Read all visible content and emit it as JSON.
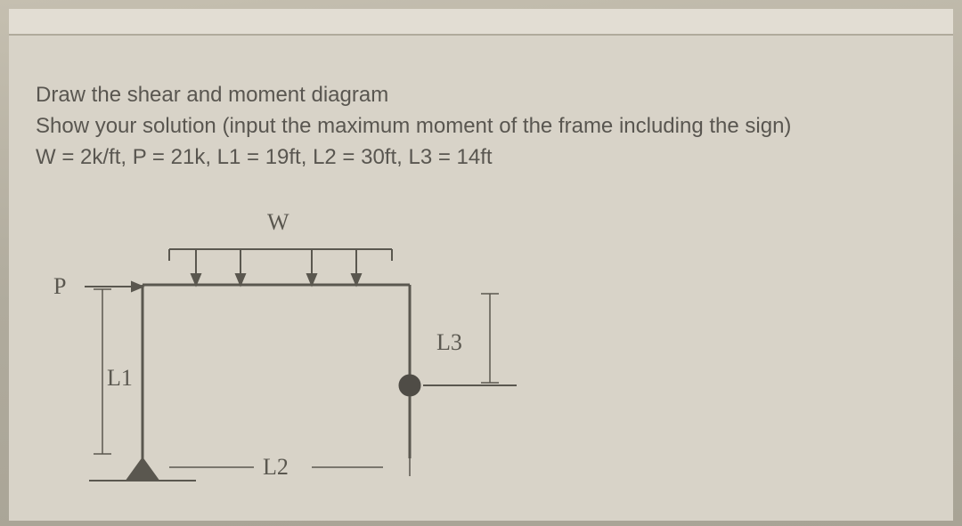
{
  "problem": {
    "line1": "Draw the shear and moment diagram",
    "line2": "Show your solution (input the maximum moment of the frame including the sign)",
    "line3": "W = 2k/ft, P = 21k, L1 = 19ft, L2 = 30ft, L3 = 14ft"
  },
  "diagram": {
    "label_W": "W",
    "label_P": "P",
    "label_L1": "L1",
    "label_L2": "L2",
    "label_L3": "L3"
  },
  "values": {
    "W": "2k/ft",
    "P": "21k",
    "L1": "19ft",
    "L2": "30ft",
    "L3": "14ft"
  }
}
